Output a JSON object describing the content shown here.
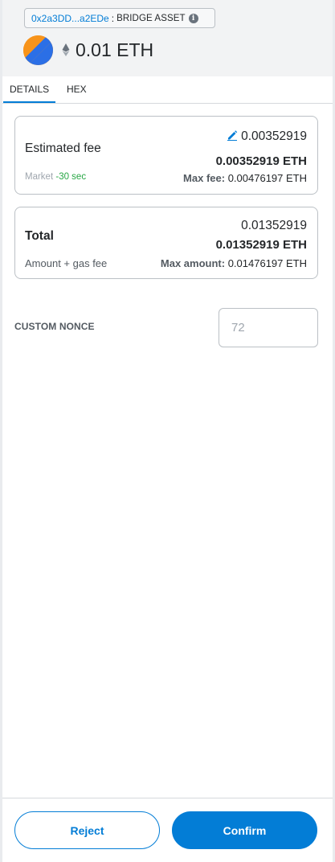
{
  "header": {
    "address": "0x2a3DD...a2EDe",
    "separator": ":",
    "method": "BRIDGE ASSET",
    "info_icon": "i",
    "amount": "0.01 ETH"
  },
  "tabs": [
    {
      "label": "DETAILS",
      "active": true
    },
    {
      "label": "HEX",
      "active": false
    }
  ],
  "fee_card": {
    "label": "Estimated fee",
    "fiat_like_value": "0.00352919",
    "value": "0.00352919 ETH",
    "speed_label": "Market",
    "speed_time": "-30 sec",
    "max_fee_label": "Max fee:",
    "max_fee_value": "0.00476197 ETH"
  },
  "total_card": {
    "label": "Total",
    "value_top": "0.01352919",
    "value": "0.01352919 ETH",
    "sub_label": "Amount + gas fee",
    "max_amount_label": "Max amount:",
    "max_amount_value": "0.01476197 ETH"
  },
  "nonce": {
    "label": "CUSTOM NONCE",
    "placeholder": "72"
  },
  "footer": {
    "reject_label": "Reject",
    "confirm_label": "Confirm"
  },
  "colors": {
    "accent": "#037dd6",
    "green": "#28a745",
    "header_bg": "#f2f3f4"
  }
}
